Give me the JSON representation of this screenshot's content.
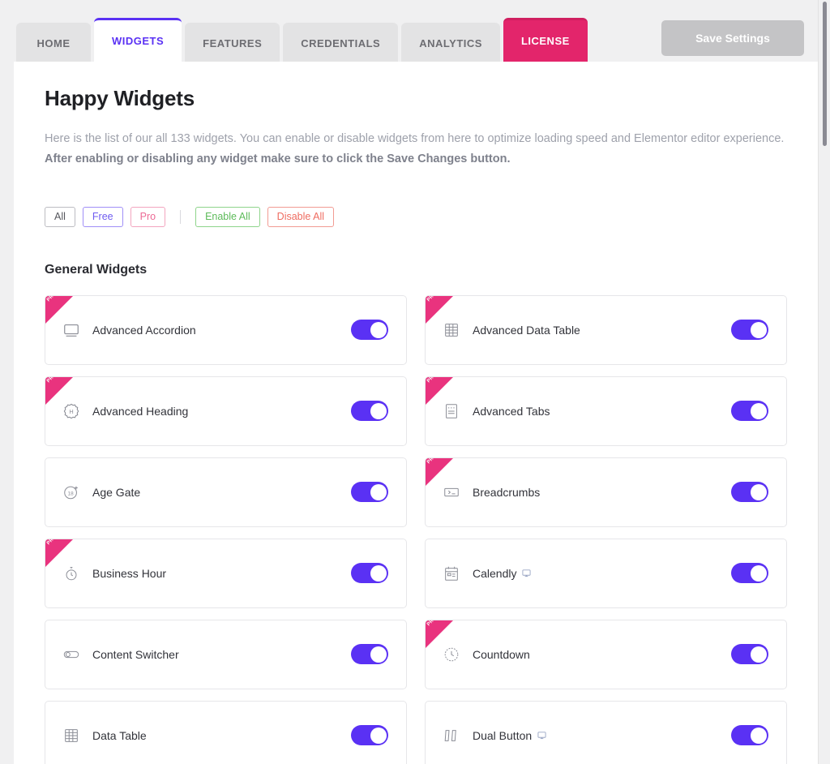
{
  "topbar": {
    "tabs": [
      {
        "label": "HOME",
        "state": "inactive"
      },
      {
        "label": "WIDGETS",
        "state": "active"
      },
      {
        "label": "FEATURES",
        "state": "inactive"
      },
      {
        "label": "CREDENTIALS",
        "state": "inactive"
      },
      {
        "label": "ANALYTICS",
        "state": "inactive"
      },
      {
        "label": "LICENSE",
        "state": "license"
      }
    ],
    "save_label": "Save Settings"
  },
  "page": {
    "title": "Happy Widgets",
    "description_lead": "Here is the list of our all 133 widgets. You can enable or disable widgets from here to optimize loading speed and Elementor editor experience. ",
    "description_bold": "After enabling or disabling any widget make sure to click the Save Changes button.",
    "widget_count": "133"
  },
  "filters": {
    "buttons": [
      {
        "label": "All",
        "style": "all"
      },
      {
        "label": "Free",
        "style": "free"
      },
      {
        "label": "Pro",
        "style": "pro"
      }
    ],
    "actions": [
      {
        "label": "Enable All",
        "style": "enable"
      },
      {
        "label": "Disable All",
        "style": "disable"
      }
    ]
  },
  "sections": [
    {
      "title": "General Widgets",
      "widgets": [
        {
          "name": "Advanced Accordion",
          "icon": "accordion-icon",
          "pro": true,
          "enabled": true,
          "demo": false
        },
        {
          "name": "Advanced Data Table",
          "icon": "data-table-icon",
          "pro": true,
          "enabled": true,
          "demo": false
        },
        {
          "name": "Advanced Heading",
          "icon": "heading-icon",
          "pro": true,
          "enabled": true,
          "demo": false
        },
        {
          "name": "Advanced Tabs",
          "icon": "tabs-icon",
          "pro": true,
          "enabled": true,
          "demo": false
        },
        {
          "name": "Age Gate",
          "icon": "age-gate-icon",
          "pro": false,
          "enabled": true,
          "demo": false
        },
        {
          "name": "Breadcrumbs",
          "icon": "breadcrumbs-icon",
          "pro": true,
          "enabled": true,
          "demo": false
        },
        {
          "name": "Business Hour",
          "icon": "clock-icon",
          "pro": true,
          "enabled": true,
          "demo": false
        },
        {
          "name": "Calendly",
          "icon": "calendar-icon",
          "pro": false,
          "enabled": true,
          "demo": true
        },
        {
          "name": "Content Switcher",
          "icon": "switcher-icon",
          "pro": false,
          "enabled": true,
          "demo": false
        },
        {
          "name": "Countdown",
          "icon": "countdown-icon",
          "pro": true,
          "enabled": true,
          "demo": false
        },
        {
          "name": "Data Table",
          "icon": "data-table-icon",
          "pro": false,
          "enabled": true,
          "demo": false
        },
        {
          "name": "Dual Button",
          "icon": "dual-button-icon",
          "pro": false,
          "enabled": true,
          "demo": true
        }
      ]
    }
  ],
  "colors": {
    "accent_purple": "#5a31f4",
    "brand_pink": "#e3256b",
    "ribbon_pink": "#e9337e",
    "enable_green": "#5dbb5a",
    "disable_red": "#ef6c60"
  },
  "ribbon_label": "PRO"
}
